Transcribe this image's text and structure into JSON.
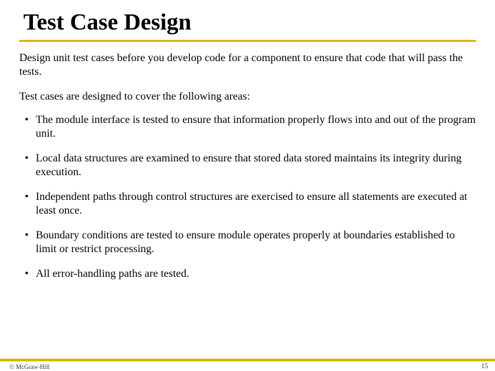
{
  "title": "Test Case Design",
  "intro": "Design unit test cases before you develop code for a component to ensure that code that will pass the tests.",
  "lead": "Test cases are designed to cover the following areas:",
  "bullets": [
    "The module interface is tested to ensure that information properly flows into and out of the program unit.",
    "Local data structures are examined to ensure that stored data stored maintains its integrity during execution.",
    "Independent paths through control structures are exercised to ensure all statements are executed at least once.",
    "Boundary conditions are tested to ensure module operates properly at boundaries established to limit or restrict processing.",
    "All error-handling paths are tested."
  ],
  "footer": {
    "copyright": "© McGraw-Hill",
    "page": "15"
  },
  "colors": {
    "accent": "#e0b400"
  }
}
